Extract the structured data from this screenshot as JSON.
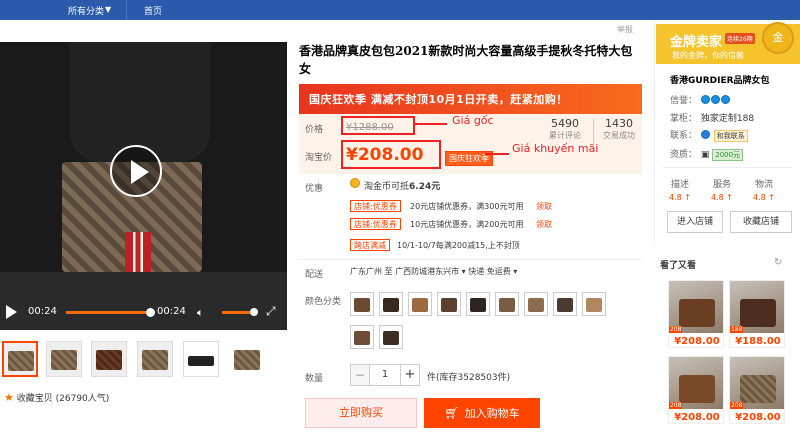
{
  "nav": {
    "all_categories": "所有分类",
    "home": "首页"
  },
  "report": "举报",
  "video": {
    "current_time": "00:24",
    "duration": "00:24"
  },
  "favorite": {
    "label": "收藏宝贝",
    "count": "(26790人气)"
  },
  "title": "香港品牌真皮包包2021新款时尚大容量高级手提秋冬托特大包女",
  "promo_banner": "国庆狂欢季 满减不封顶10月1日开卖，赶紧加购！",
  "price": {
    "old_label": "价格",
    "old_value": "¥1288.00",
    "new_label": "淘宝价",
    "new_value": "¥208.00",
    "badge": "国庆狂欢季",
    "annotation_old": "Giá gốc",
    "annotation_new": "Giá khuyến mãi"
  },
  "stats": {
    "reviews_num": "5490",
    "reviews_label": "累计评论",
    "sold_num": "1430",
    "sold_label": "交易成功"
  },
  "discounts": {
    "label": "优惠",
    "coin_text": "淘金币可抵",
    "coin_amount": "6.24元",
    "coupons": [
      {
        "tag": "店铺:优惠券",
        "text": "20元店铺优惠券，满300元可用",
        "link": "领取"
      },
      {
        "tag": "店铺:优惠券",
        "text": "10元店铺优惠券，满200元可用",
        "link": "领取"
      },
      {
        "tag": "跨店满减",
        "text": "10/1-10/7每满200减15,上不封顶",
        "link": ""
      }
    ]
  },
  "shipping": {
    "label": "配送",
    "from": "广东广州 至",
    "to": "广西防城港东兴市",
    "method": "快递 免运费"
  },
  "colors": {
    "label": "颜色分类"
  },
  "quantity": {
    "label": "数量",
    "value": "1",
    "stock": "件(库存3528503件)"
  },
  "buttons": {
    "buy_now": "立即购买",
    "add_cart": "加入购物车"
  },
  "shop": {
    "gold_title": "金牌卖家",
    "gold_tag": "连续26期",
    "gold_sub": "我的金牌，你的信赖",
    "medal": "金",
    "name": "香港GURDIER品牌女包",
    "credit_label": "信誉：",
    "keeper_label": "掌柜：",
    "keeper_value": "独家定制188",
    "contact_label": "联系：",
    "contact_value": "和我联系",
    "deposit_label": "资质：",
    "deposit_value": "2000元",
    "rates": [
      {
        "name": "描述",
        "value": "4.8 ↑"
      },
      {
        "name": "服务",
        "value": "4.8 ↑"
      },
      {
        "name": "物流",
        "value": "4.8 ↑"
      }
    ],
    "enter": "进入店铺",
    "collect": "收藏店铺"
  },
  "seen": {
    "title": "看了又看",
    "items": [
      {
        "price": "¥208.00",
        "tag": "208"
      },
      {
        "price": "¥188.00",
        "tag": "188"
      },
      {
        "price": "¥208.00",
        "tag": "208"
      },
      {
        "price": "¥208.00",
        "tag": "208"
      }
    ]
  }
}
